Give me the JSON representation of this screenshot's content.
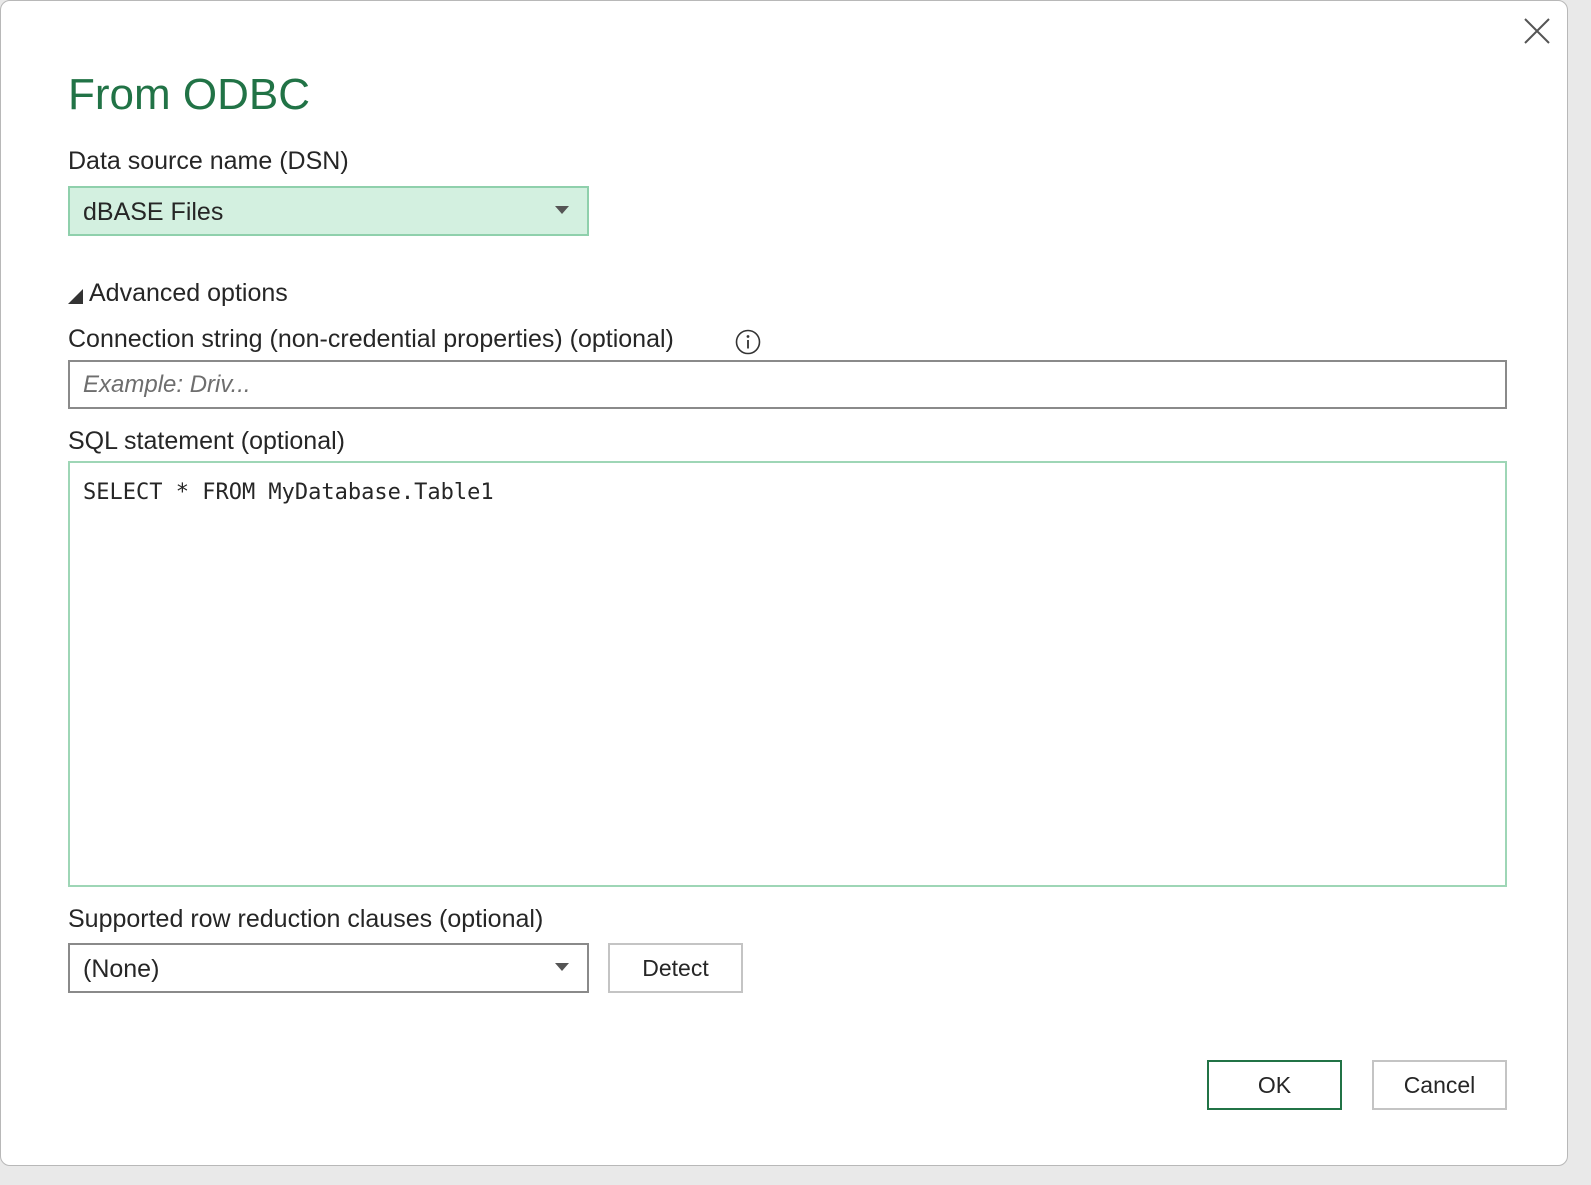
{
  "dialog": {
    "title": "From ODBC"
  },
  "dsn": {
    "label": "Data source name (DSN)",
    "selected": "dBASE Files"
  },
  "advanced": {
    "toggle_label": "Advanced options",
    "expanded": true,
    "connection_string": {
      "label": "Connection string (non-credential properties) (optional)",
      "value": "",
      "placeholder": "Example: Driv..."
    },
    "sql_statement": {
      "label": "SQL statement (optional)",
      "value": "SELECT * FROM MyDatabase.Table1"
    },
    "row_reduction": {
      "label": "Supported row reduction clauses (optional)",
      "selected": "(None)",
      "detect_label": "Detect"
    }
  },
  "footer": {
    "ok_label": "OK",
    "cancel_label": "Cancel"
  },
  "colors": {
    "accent": "#217346",
    "active_select_bg": "#d3f0e0",
    "focus_border": "#9ed6b6"
  },
  "icons": {
    "close": "close-icon",
    "caret": "chevron-down-icon",
    "toggle": "expanded-triangle-icon",
    "info": "info-icon"
  }
}
